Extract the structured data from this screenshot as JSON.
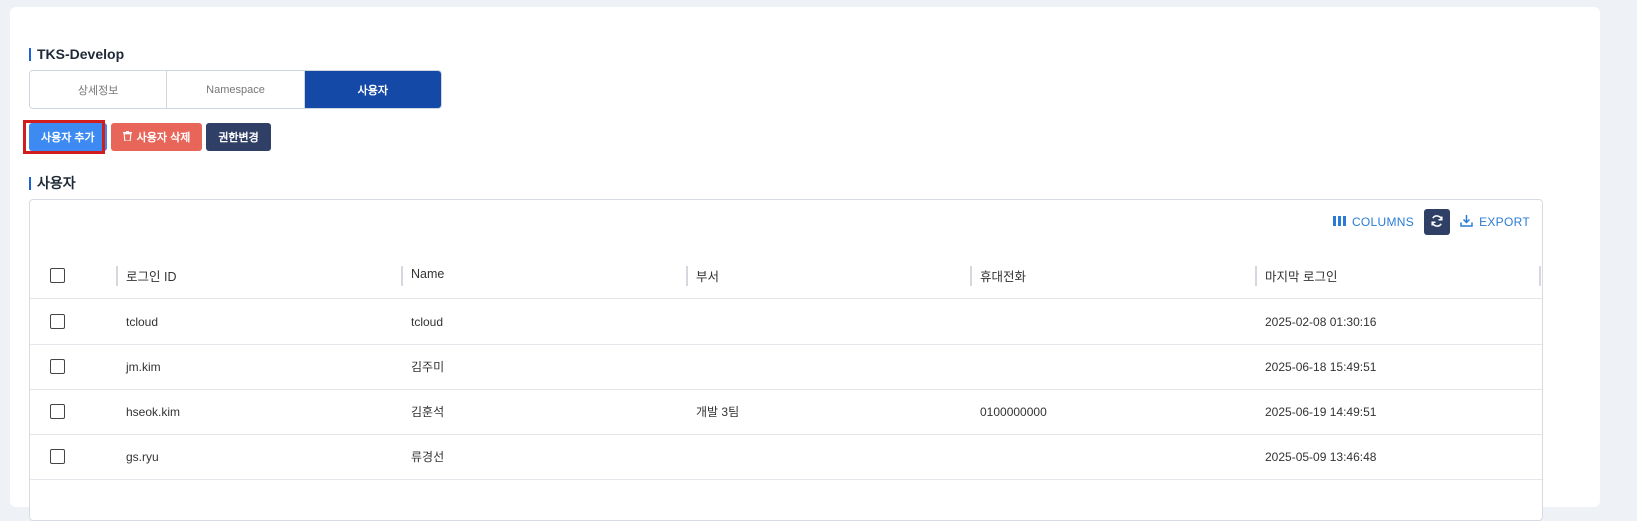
{
  "project": {
    "title": "TKS-Develop"
  },
  "tabs": [
    {
      "label": "상세정보"
    },
    {
      "label": "Namespace"
    },
    {
      "label": "사용자"
    }
  ],
  "actions": {
    "add_label": "사용자 추가",
    "delete_label": "사용자 삭제",
    "role_label": "권한변경"
  },
  "users_section": {
    "title": "사용자"
  },
  "toolbar": {
    "columns_label": "COLUMNS",
    "export_label": "EXPORT"
  },
  "table": {
    "headers": [
      "로그인 ID",
      "Name",
      "부서",
      "휴대전화",
      "마지막 로그인"
    ],
    "rows": [
      {
        "login_id": "tcloud",
        "name": "tcloud",
        "dept": "",
        "phone": "",
        "last_login": "2025-02-08 01:30:16"
      },
      {
        "login_id": "jm.kim",
        "name": "김주미",
        "dept": "",
        "phone": "",
        "last_login": "2025-06-18 15:49:51"
      },
      {
        "login_id": "hseok.kim",
        "name": "김훈석",
        "dept": "개발 3팀",
        "phone": "0100000000",
        "last_login": "2025-06-19 14:49:51"
      },
      {
        "login_id": "gs.ryu",
        "name": "류경선",
        "dept": "",
        "phone": "",
        "last_login": "2025-05-09 13:46:48"
      }
    ]
  },
  "colors": {
    "accent": "#1e63d6",
    "active_tab": "#1549a8",
    "add_button": "#3d8bf2",
    "delete_button": "#e76559",
    "role_button": "#2f3f66",
    "highlight": "#d21d1d"
  }
}
